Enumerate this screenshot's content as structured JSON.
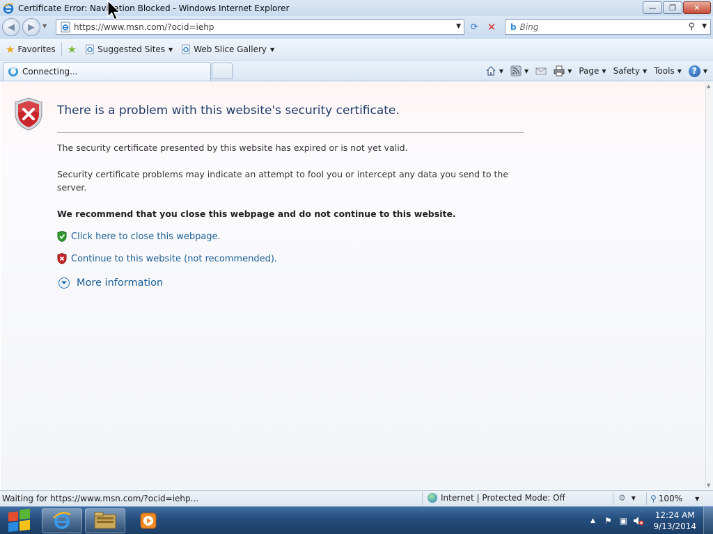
{
  "window": {
    "title": "Certificate Error: Navigation Blocked - Windows Internet Explorer",
    "min_glyph": "—",
    "max_glyph": "❐",
    "close_glyph": "✕"
  },
  "nav": {
    "back_glyph": "◀",
    "forward_glyph": "▶",
    "address": "https://www.msn.com/?ocid=iehp",
    "refresh_glyph": "⟳",
    "stop_glyph": "✕",
    "search_placeholder": "Bing",
    "bing_glyph": "b",
    "search_glyph": "⚲"
  },
  "favorites": {
    "favorites_label": "Favorites",
    "suggested_label": "Suggested Sites",
    "webslice_label": "Web Slice Gallery"
  },
  "tabs": {
    "active_label": "Connecting..."
  },
  "commands": {
    "page_label": "Page",
    "safety_label": "Safety",
    "tools_label": "Tools",
    "help_glyph": "?"
  },
  "error": {
    "title": "There is a problem with this website's security certificate.",
    "p1": "The security certificate presented by this website has expired or is not yet valid.",
    "p2": "Security certificate problems may indicate an attempt to fool you or intercept any data you send to the server.",
    "recommend": "We recommend that you close this webpage and do not continue to this website.",
    "close_link": "Click here to close this webpage.",
    "continue_link": "Continue to this website (not recommended).",
    "more_info": "More information"
  },
  "status": {
    "text": "Waiting for https://www.msn.com/?ocid=iehp...",
    "zone": "Internet | Protected Mode: Off",
    "zoom": "100%"
  },
  "taskbar": {
    "time": "12:24 AM",
    "date": "9/13/2014"
  },
  "colors": {
    "link": "#1a5d93",
    "title": "#1f3d6a",
    "error_red": "#c8262b",
    "safe_green": "#2e9a2e"
  },
  "icons": [
    "ie-logo-icon",
    "back-arrow-icon",
    "forward-arrow-icon",
    "page-icon",
    "refresh-icon",
    "stop-icon",
    "bing-icon",
    "search-icon",
    "star-icon",
    "add-favorites-icon",
    "home-icon",
    "rss-icon",
    "mail-icon",
    "print-icon",
    "help-icon",
    "error-shield-icon",
    "safe-shield-icon",
    "expand-icon",
    "globe-icon",
    "zoom-icon",
    "windows-logo-icon",
    "flag-icon",
    "network-icon",
    "volume-muted-icon"
  ]
}
